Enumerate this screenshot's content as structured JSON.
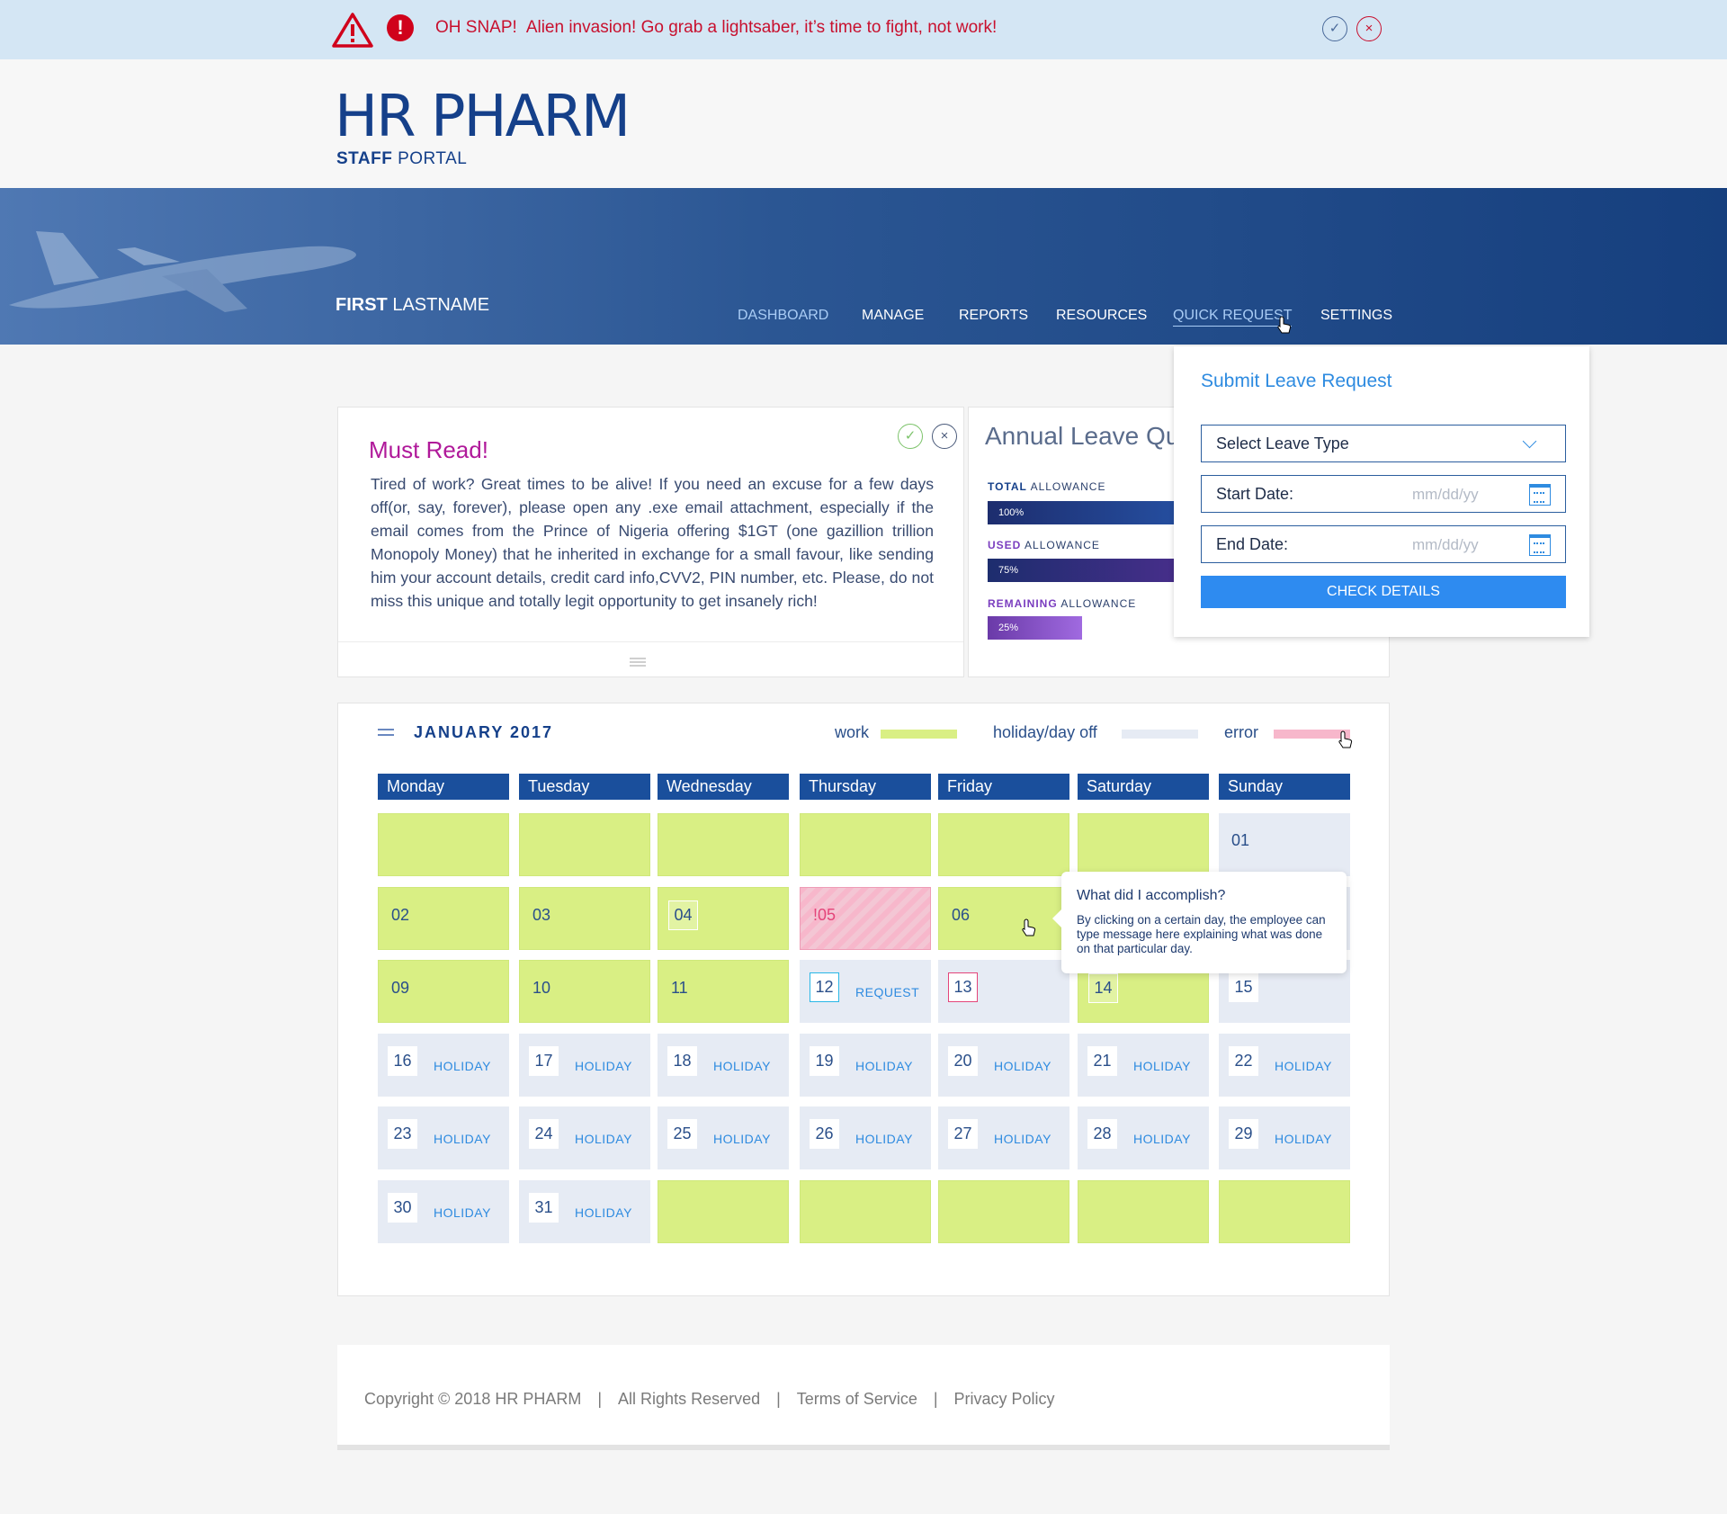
{
  "alert": {
    "heading": "OH SNAP!",
    "message": "Alien invasion! Go grab a lightsaber, it’s time to fight, not work!",
    "accept": "✓",
    "dismiss": "×"
  },
  "logo": {
    "main": "HR PHARM",
    "sub_bold": "STAFF",
    "sub_rest": " PORTAL"
  },
  "user": {
    "first": "FIRST",
    "last": " LASTNAME"
  },
  "nav": {
    "dashboard": "DASHBOARD",
    "manage": "MANAGE",
    "reports": "REPORTS",
    "resources": "RESOURCES",
    "quick_request": "QUICK REQUEST",
    "settings": "SETTINGS"
  },
  "must_read": {
    "title": "Must Read!",
    "text": "Tired of work? Great times to be alive! If you need an excuse for a few days off(or, say, forever), please open any .exe email attachment, especially if the email comes from the Prince of Nigeria offering $1GT (one gazillion trillion Monopoly Money) that he inherited in exchange for a small favour, like sending him your account details, credit card info,CVV2, PIN number, etc. Please, do not miss this unique and totally legit opportunity to get insanely rich!",
    "accept": "✓",
    "dismiss": "×"
  },
  "annual_leave": {
    "title": "Annual Leave Qu",
    "rows": [
      {
        "label_bold": "TOTAL",
        "label_rest": " ALLOWANCE",
        "value_text": "100%",
        "fraction": 1.0
      },
      {
        "label_bold": "USED",
        "label_rest": " ALLOWANCE",
        "value_text": "75%",
        "fraction": 0.75
      },
      {
        "label_bold": "REMAINING",
        "label_rest": " ALLOWANCE",
        "value_text": "25%",
        "fraction": 0.25
      }
    ]
  },
  "leave_request": {
    "title": "Submit Leave Request",
    "leave_type": "Select Leave Type",
    "start_label": "Start Date:",
    "start_placeholder": "mm/dd/yy",
    "end_label": "End Date:",
    "end_placeholder": "mm/dd/yy",
    "button": "CHECK DETAILS"
  },
  "calendar": {
    "month": "JANUARY 2017",
    "legend": {
      "work": "work",
      "holiday": "holiday/day off",
      "error": "error"
    },
    "days": [
      "Monday",
      "Tuesday",
      "Wednesday",
      "Thursday",
      "Friday",
      "Saturday",
      "Sunday"
    ],
    "rows": [
      [
        {
          "t": "work",
          "n": ""
        },
        {
          "t": "work",
          "n": ""
        },
        {
          "t": "work",
          "n": ""
        },
        {
          "t": "work",
          "n": ""
        },
        {
          "t": "work",
          "n": ""
        },
        {
          "t": "work",
          "n": ""
        },
        {
          "t": "off",
          "n": "01"
        }
      ],
      [
        {
          "t": "work",
          "n": "02"
        },
        {
          "t": "work",
          "n": "03"
        },
        {
          "t": "work",
          "n": "04",
          "box": "white"
        },
        {
          "t": "err",
          "n": "!05"
        },
        {
          "t": "work",
          "n": "06"
        },
        {
          "t": "work",
          "n": ""
        },
        {
          "t": "off",
          "n": ""
        }
      ],
      [
        {
          "t": "work",
          "n": "09"
        },
        {
          "t": "work",
          "n": "10"
        },
        {
          "t": "work",
          "n": "11"
        },
        {
          "t": "off",
          "n": "12",
          "box": "cyan",
          "tag": "REQUEST"
        },
        {
          "t": "off",
          "n": "13",
          "box": "pink"
        },
        {
          "t": "work",
          "n": "14",
          "box": "white"
        },
        {
          "t": "off",
          "n": "15",
          "box": "white"
        }
      ],
      [
        {
          "t": "off",
          "n": "16",
          "box": "white",
          "tag": "HOLIDAY"
        },
        {
          "t": "off",
          "n": "17",
          "box": "white",
          "tag": "HOLIDAY"
        },
        {
          "t": "off",
          "n": "18",
          "box": "white",
          "tag": "HOLIDAY"
        },
        {
          "t": "off",
          "n": "19",
          "box": "white",
          "tag": "HOLIDAY"
        },
        {
          "t": "off",
          "n": "20",
          "box": "white",
          "tag": "HOLIDAY"
        },
        {
          "t": "off",
          "n": "21",
          "box": "white",
          "tag": "HOLIDAY"
        },
        {
          "t": "off",
          "n": "22",
          "box": "white",
          "tag": "HOLIDAY"
        }
      ],
      [
        {
          "t": "off",
          "n": "23",
          "box": "white",
          "tag": "HOLIDAY"
        },
        {
          "t": "off",
          "n": "24",
          "box": "white",
          "tag": "HOLIDAY"
        },
        {
          "t": "off",
          "n": "25",
          "box": "white",
          "tag": "HOLIDAY"
        },
        {
          "t": "off",
          "n": "26",
          "box": "white",
          "tag": "HOLIDAY"
        },
        {
          "t": "off",
          "n": "27",
          "box": "white",
          "tag": "HOLIDAY"
        },
        {
          "t": "off",
          "n": "28",
          "box": "white",
          "tag": "HOLIDAY"
        },
        {
          "t": "off",
          "n": "29",
          "box": "white",
          "tag": "HOLIDAY"
        }
      ],
      [
        {
          "t": "off",
          "n": "30",
          "box": "white",
          "tag": "HOLIDAY"
        },
        {
          "t": "off",
          "n": "31",
          "box": "white",
          "tag": "HOLIDAY"
        },
        {
          "t": "work",
          "n": ""
        },
        {
          "t": "work",
          "n": ""
        },
        {
          "t": "work",
          "n": ""
        },
        {
          "t": "work",
          "n": ""
        },
        {
          "t": "work",
          "n": ""
        }
      ]
    ]
  },
  "tooltip": {
    "title": "What did I accomplish?",
    "body": "By clicking on a certain day, the employee can type message here explaining what was done on that particular day."
  },
  "footer": {
    "copyright": "Copyright © 2018 HR PHARM",
    "rights": "All Rights Reserved",
    "terms": "Terms of Service",
    "privacy": "Privacy Policy",
    "separator": "|"
  },
  "colors": {
    "brand": "#15408a",
    "accent": "#2e8bf0",
    "alert": "#c8102e",
    "work": "#d9ef84",
    "holiday": "#e6ebf4",
    "error": "#f7b7cb"
  },
  "icons": [
    "warning-triangle-icon",
    "exclamation-icon",
    "check-icon",
    "close-icon",
    "chevron-down-icon",
    "calendar-icon",
    "menu-icon",
    "pointer-cursor-icon"
  ]
}
